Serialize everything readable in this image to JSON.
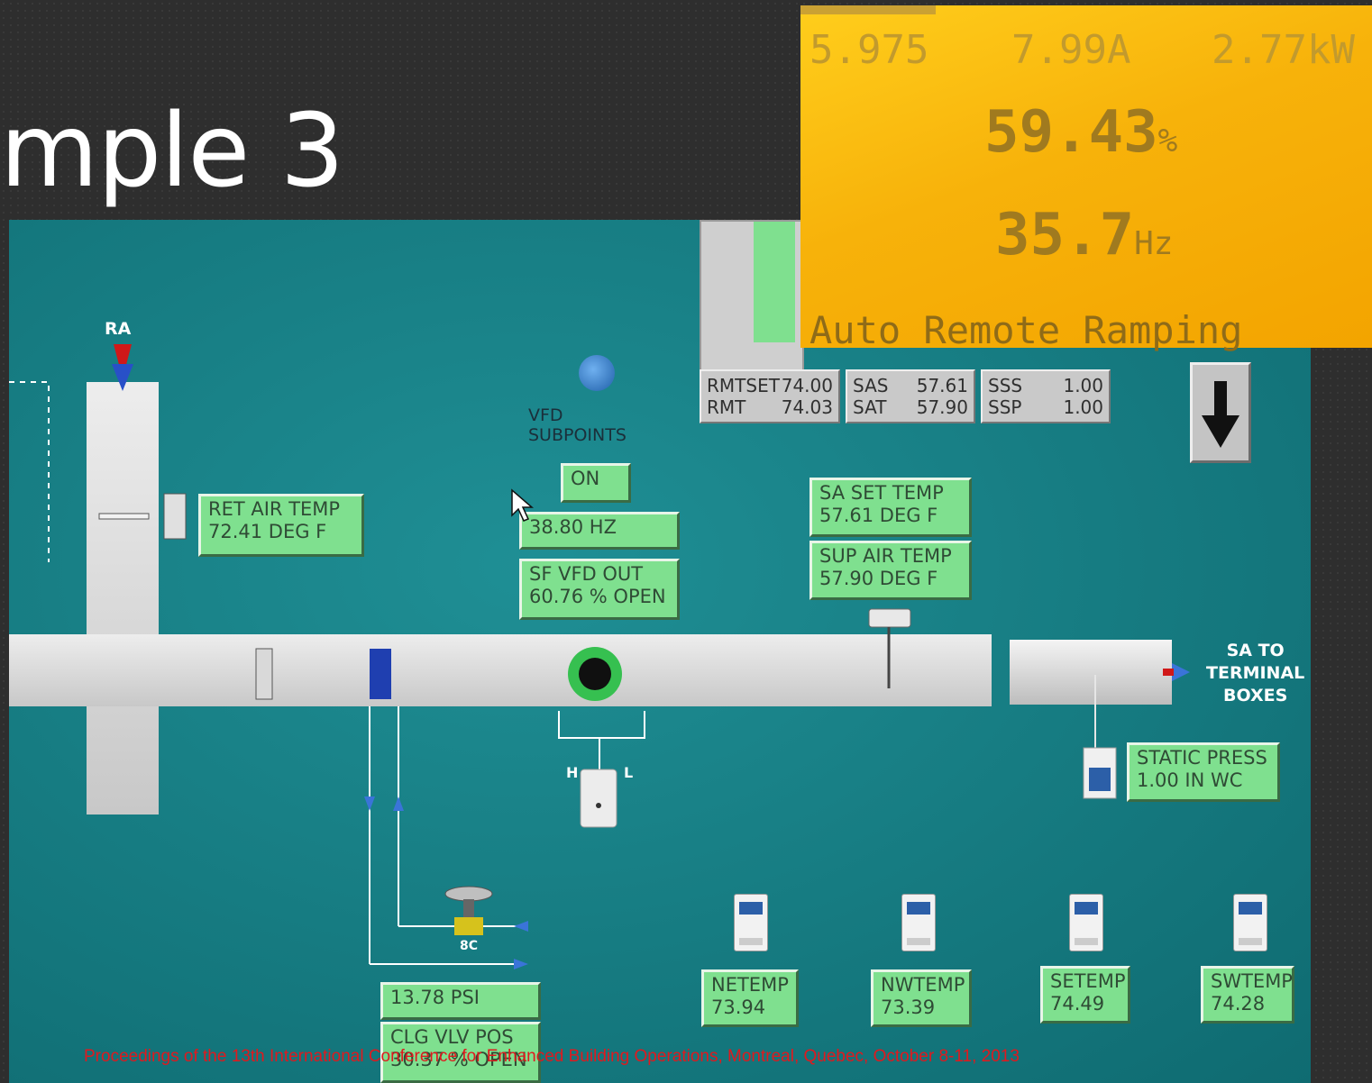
{
  "slide_title": "mple 3",
  "vfd_display": {
    "voltage_reading": "5.975",
    "current_reading": "7.99A",
    "power_reading": "2.77kW",
    "speed_percent_value": "59.43",
    "speed_percent_unit": "%",
    "frequency_value": "35.7",
    "frequency_unit": "Hz",
    "status_text": "Auto Remote Ramping"
  },
  "diagram": {
    "ra_label": "RA",
    "vfd_subpoints_label": "VFD SUBPOINTS",
    "fan_status": "ON",
    "fan_hz": "38.80 HZ",
    "sf_vfd_out": {
      "line1": "SF VFD OUT",
      "line2": "60.76 % OPEN"
    },
    "ret_air_temp": {
      "line1": "RET AIR TEMP",
      "line2": "72.41 DEG F"
    },
    "sa_set_temp": {
      "line1": "SA SET TEMP",
      "line2": "57.61 DEG F"
    },
    "sup_air_temp": {
      "line1": "SUP AIR TEMP",
      "line2": "57.90 DEG F"
    },
    "static_press": {
      "line1": "STATIC PRESS",
      "line2": "1.00 IN WC"
    },
    "chw_pressure": "13.78 PSI",
    "clg_vlv_pos": {
      "line1": "CLG VLV POS",
      "line2": "30.37 % OPEN"
    },
    "valve_label": "8C",
    "sensor_h": "H",
    "sensor_l": "L",
    "sa_to_terminal_line1": "SA TO",
    "sa_to_terminal_line2": "TERMINAL",
    "sa_to_terminal_line3": "BOXES",
    "setpoint_panels": [
      {
        "rows": [
          {
            "label": "RMTSET",
            "value": "74.00"
          },
          {
            "label": "RMT",
            "value": "74.03"
          }
        ]
      },
      {
        "rows": [
          {
            "label": "SAS",
            "value": "57.61"
          },
          {
            "label": "SAT",
            "value": "57.90"
          }
        ]
      },
      {
        "rows": [
          {
            "label": "SSS",
            "value": "1.00"
          },
          {
            "label": "SSP",
            "value": "1.00"
          }
        ]
      }
    ],
    "zone_temps": [
      {
        "name": "NETEMP",
        "value": "73.94"
      },
      {
        "name": "NWTEMP",
        "value": "73.39"
      },
      {
        "name": "SETEMP",
        "value": "74.49"
      },
      {
        "name": "SWTEMP",
        "value": "74.28"
      }
    ]
  },
  "footer": "Proceedings of the 13th International Conference for Enhanced Building Operations, Montreal, Quebec, October 8-11, 2013",
  "colors": {
    "screen_bg": "#15797f",
    "value_box": "#7fe08f",
    "lcd_bg": "#f7b20a",
    "footer_text": "#e0191e"
  }
}
